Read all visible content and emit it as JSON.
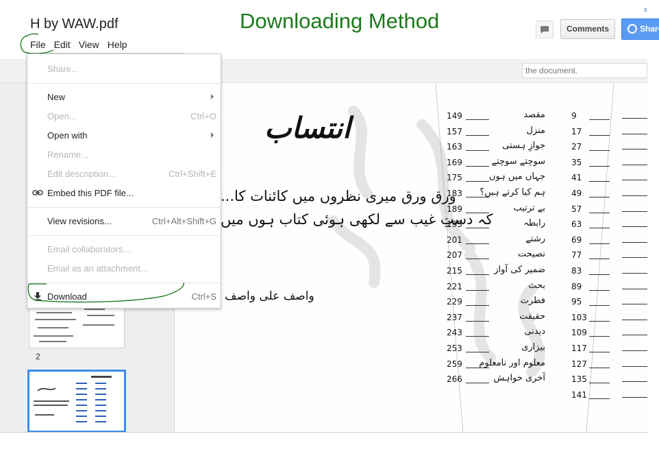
{
  "header": {
    "doc_title": "H by WAW.pdf",
    "headline": "Downloading Method",
    "headline_color": "#1c7a1c",
    "comments_label": "Comments",
    "share_label": "Share",
    "top_link": "s"
  },
  "menubar": [
    "File",
    "Edit",
    "View",
    "Help"
  ],
  "search": {
    "value": "the document."
  },
  "file_menu": [
    {
      "label": "Share...",
      "shortcut": "",
      "disabled": true,
      "submenu": false,
      "icon": ""
    },
    {
      "separator": true
    },
    {
      "label": "New",
      "shortcut": "",
      "disabled": false,
      "submenu": true,
      "icon": ""
    },
    {
      "label": "Open...",
      "shortcut": "Ctrl+O",
      "disabled": true,
      "submenu": false,
      "icon": ""
    },
    {
      "label": "Open with",
      "shortcut": "",
      "disabled": false,
      "submenu": true,
      "icon": ""
    },
    {
      "label": "Rename...",
      "shortcut": "",
      "disabled": true,
      "submenu": false,
      "icon": ""
    },
    {
      "label": "Edit description...",
      "shortcut": "Ctrl+Shift+E",
      "disabled": true,
      "submenu": false,
      "icon": ""
    },
    {
      "label": "Embed this PDF file...",
      "shortcut": "",
      "disabled": false,
      "submenu": false,
      "icon": "link-icon"
    },
    {
      "separator": true
    },
    {
      "label": "View revisions...",
      "shortcut": "Ctrl+Alt+Shift+G",
      "disabled": false,
      "submenu": false,
      "icon": ""
    },
    {
      "separator": true
    },
    {
      "label": "Email collaborators...",
      "shortcut": "",
      "disabled": true,
      "submenu": false,
      "icon": ""
    },
    {
      "label": "Email as an attachment...",
      "shortcut": "",
      "disabled": true,
      "submenu": false,
      "icon": ""
    },
    {
      "separator": true
    },
    {
      "label": "Download",
      "shortcut": "Ctrl+S",
      "disabled": false,
      "submenu": false,
      "icon": "download-icon"
    }
  ],
  "thumbnails": {
    "page_2_label": "2"
  },
  "document": {
    "heading": "انتساب",
    "line_1": "ورق ورق میری نظروں میں کائنات کا...",
    "line_2": "کہ دستِ غیب سے لکھی ہوئی کتاب ہوں میں",
    "signature": "واصف علی واصف",
    "toc": [
      {
        "title": "مقصد",
        "page": "149",
        "left_num": "9"
      },
      {
        "title": "منزل",
        "page": "157",
        "left_num": "17"
      },
      {
        "title": "جوازِ ہستی",
        "page": "163",
        "left_num": "27"
      },
      {
        "title": "سوچتے سوچتے",
        "page": "169",
        "left_num": "35"
      },
      {
        "title": "جہاں میں ہوں",
        "page": "175",
        "left_num": "41"
      },
      {
        "title": "ہم کیا کرتے ہیں؟",
        "page": "183",
        "left_num": "49"
      },
      {
        "title": "بے ترتیب",
        "page": "189",
        "left_num": "57"
      },
      {
        "title": "رابطہ",
        "page": "195",
        "left_num": "63"
      },
      {
        "title": "رشتے",
        "page": "201",
        "left_num": "69"
      },
      {
        "title": "نصیحت",
        "page": "207",
        "left_num": "77"
      },
      {
        "title": "ضمیر کی آواز",
        "page": "215",
        "left_num": "83"
      },
      {
        "title": "بحث",
        "page": "221",
        "left_num": "89"
      },
      {
        "title": "فطرت",
        "page": "229",
        "left_num": "95"
      },
      {
        "title": "حقیقت",
        "page": "237",
        "left_num": "103"
      },
      {
        "title": "دیدنی",
        "page": "243",
        "left_num": "109"
      },
      {
        "title": "بیزاری",
        "page": "253",
        "left_num": "117"
      },
      {
        "title": "معلوم اور نامعلوم",
        "page": "259",
        "left_num": "127"
      },
      {
        "title": "آخری خواہش",
        "page": "266",
        "left_num": "135"
      },
      {
        "title": "",
        "page": "",
        "left_num": "141"
      }
    ]
  },
  "colors": {
    "accent_blue": "#3c8de8",
    "annotation_green": "#0a6b0a"
  }
}
